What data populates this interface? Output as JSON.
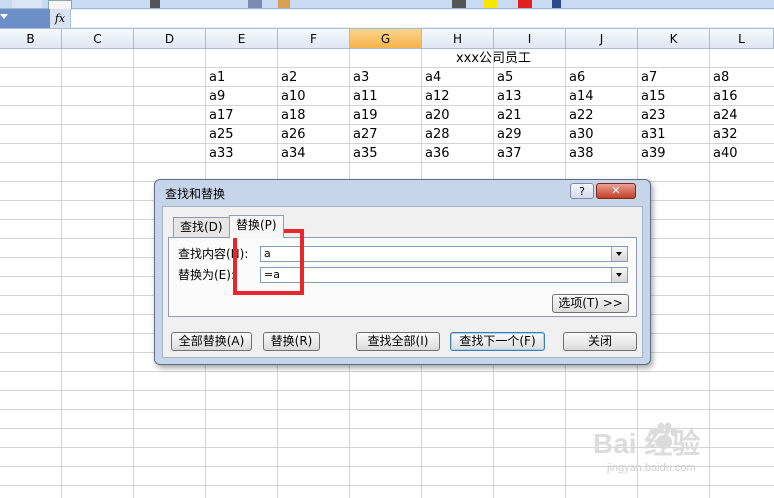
{
  "formula_bar": {
    "fx_label": "fx",
    "value": ""
  },
  "columns": [
    "B",
    "C",
    "D",
    "E",
    "F",
    "G",
    "H",
    "I",
    "J",
    "K",
    "L"
  ],
  "selected_column": "G",
  "sheet": {
    "title": "xxx公司员工",
    "rows": [
      [
        "a1",
        "a2",
        "a3",
        "a4",
        "a5",
        "a6",
        "a7",
        "a8"
      ],
      [
        "a9",
        "a10",
        "a11",
        "a12",
        "a13",
        "a14",
        "a15",
        "a16"
      ],
      [
        "a17",
        "a18",
        "a19",
        "a20",
        "a21",
        "a22",
        "a23",
        "a24"
      ],
      [
        "a25",
        "a26",
        "a27",
        "a28",
        "a29",
        "a30",
        "a31",
        "a32"
      ],
      [
        "a33",
        "a34",
        "a35",
        "a36",
        "a37",
        "a38",
        "a39",
        "a40"
      ]
    ]
  },
  "dialog": {
    "title": "查找和替换",
    "help": "?",
    "close": "✕",
    "tabs": [
      {
        "label": "查找(D)"
      },
      {
        "label": "替换(P)"
      }
    ],
    "find_label": "查找内容(N):",
    "find_value": "a",
    "replace_label": "替换为(E):",
    "replace_value": "=a",
    "options_button": "选项(T) >>",
    "buttons": {
      "replace_all": "全部替换(A)",
      "replace": "替换(R)",
      "find_all": "查找全部(I)",
      "find_next": "查找下一个(F)",
      "close": "关闭"
    }
  },
  "watermark": {
    "brand": "Bai  经验",
    "url": "jingyan.baidu.com"
  },
  "colors": {
    "selected_header": "#f6b34a",
    "annotation": "#e8262b",
    "dialog_frame": "#c7d5ea"
  }
}
